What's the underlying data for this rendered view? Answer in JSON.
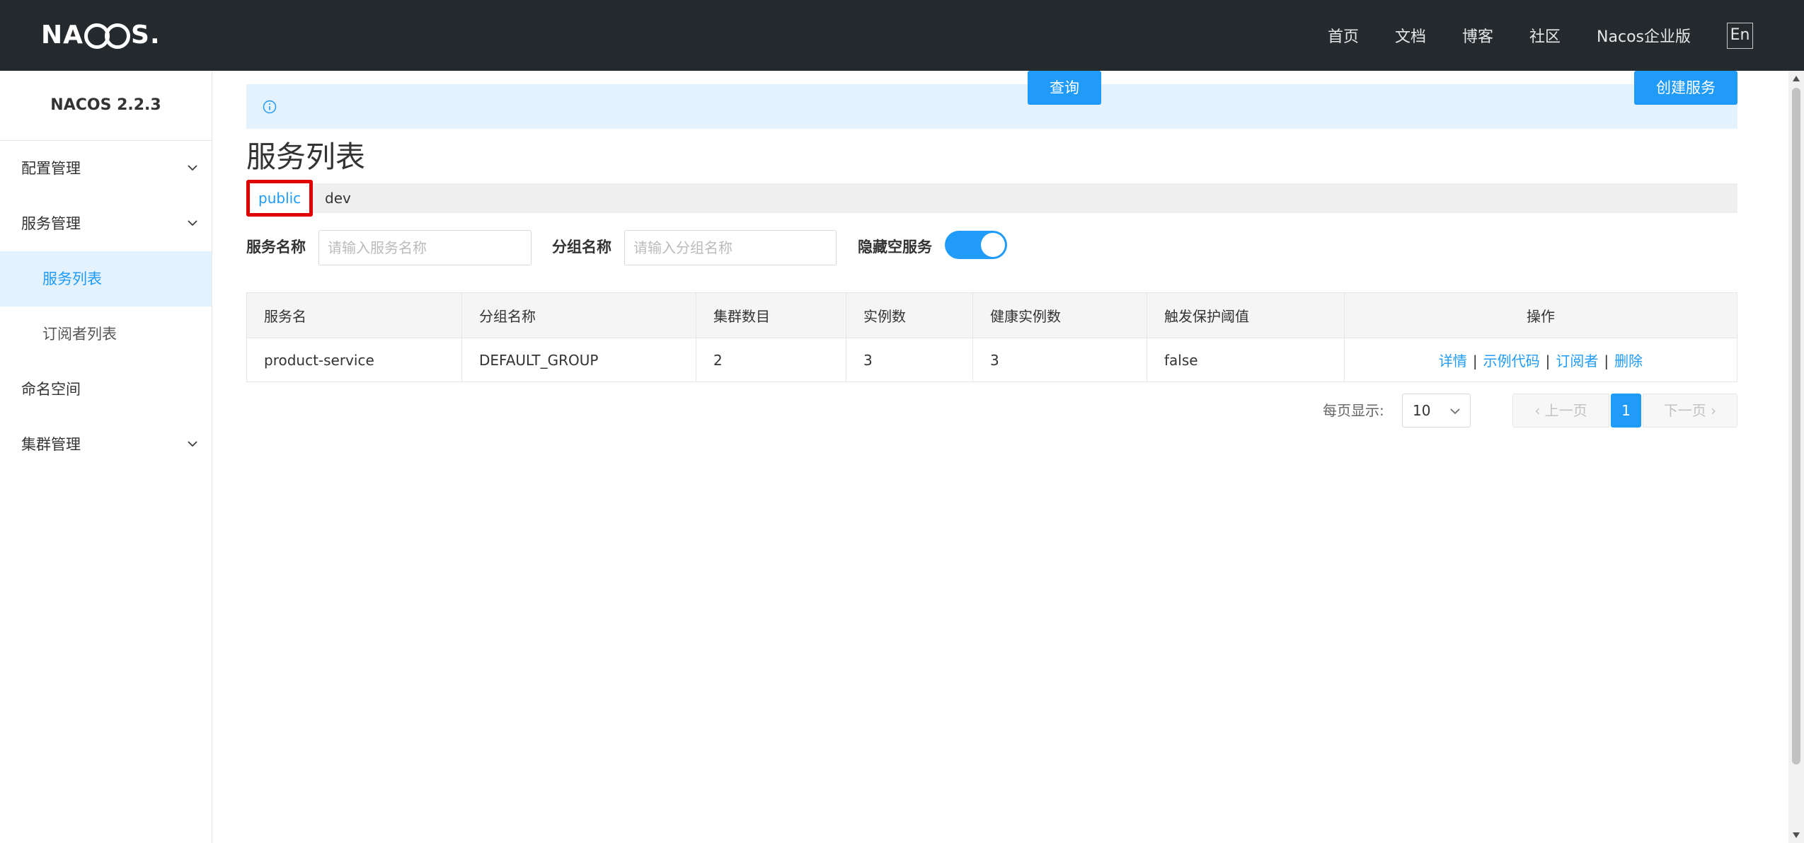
{
  "topbar": {
    "logo_text_left": "NA",
    "logo_text_right": "S",
    "logo_dot": ".",
    "nav_items": [
      "首页",
      "文档",
      "博客",
      "社区",
      "Nacos企业版"
    ],
    "lang_label": "En",
    "background": "#252a2f"
  },
  "sidebar": {
    "title": "NACOS 2.2.3",
    "items": [
      {
        "label": "配置管理",
        "icon": "chevron-down-icon"
      },
      {
        "label": "服务管理",
        "icon": "chevron-down-icon"
      },
      {
        "label": "服务列表",
        "active": true
      },
      {
        "label": "订阅者列表"
      },
      {
        "label": "命名空间"
      },
      {
        "label": "集群管理",
        "icon": "chevron-down-icon"
      }
    ]
  },
  "main": {
    "notice_icon": "info-icon",
    "page_title": "服务列表",
    "namespaces": [
      {
        "label": "public",
        "selected": true
      },
      {
        "label": "dev"
      }
    ],
    "filters": {
      "service_name_label": "服务名称",
      "service_name_placeholder": "请输入服务名称",
      "group_name_label": "分组名称",
      "group_name_placeholder": "请输入分组名称",
      "hide_empty_label": "隐藏空服务",
      "hide_empty_on": true,
      "query_button": "查询",
      "create_button": "创建服务"
    },
    "table": {
      "headers": [
        "服务名",
        "分组名称",
        "集群数目",
        "实例数",
        "健康实例数",
        "触发保护阈值",
        "操作"
      ],
      "rows": [
        {
          "service": "product-service",
          "group": "DEFAULT_GROUP",
          "clusters": "2",
          "instances": "3",
          "healthy": "3",
          "threshold": "false",
          "actions": [
            "详情",
            "示例代码",
            "订阅者",
            "删除"
          ],
          "separator": "|"
        }
      ]
    },
    "pagination": {
      "page_size_label": "每页显示:",
      "page_size": "10",
      "prev": "上一页",
      "current": "1",
      "next": "下一页"
    }
  },
  "colors": {
    "accent": "#209bfa",
    "notice_bg": "#e3f2fd",
    "highlight_border": "#e00000"
  }
}
